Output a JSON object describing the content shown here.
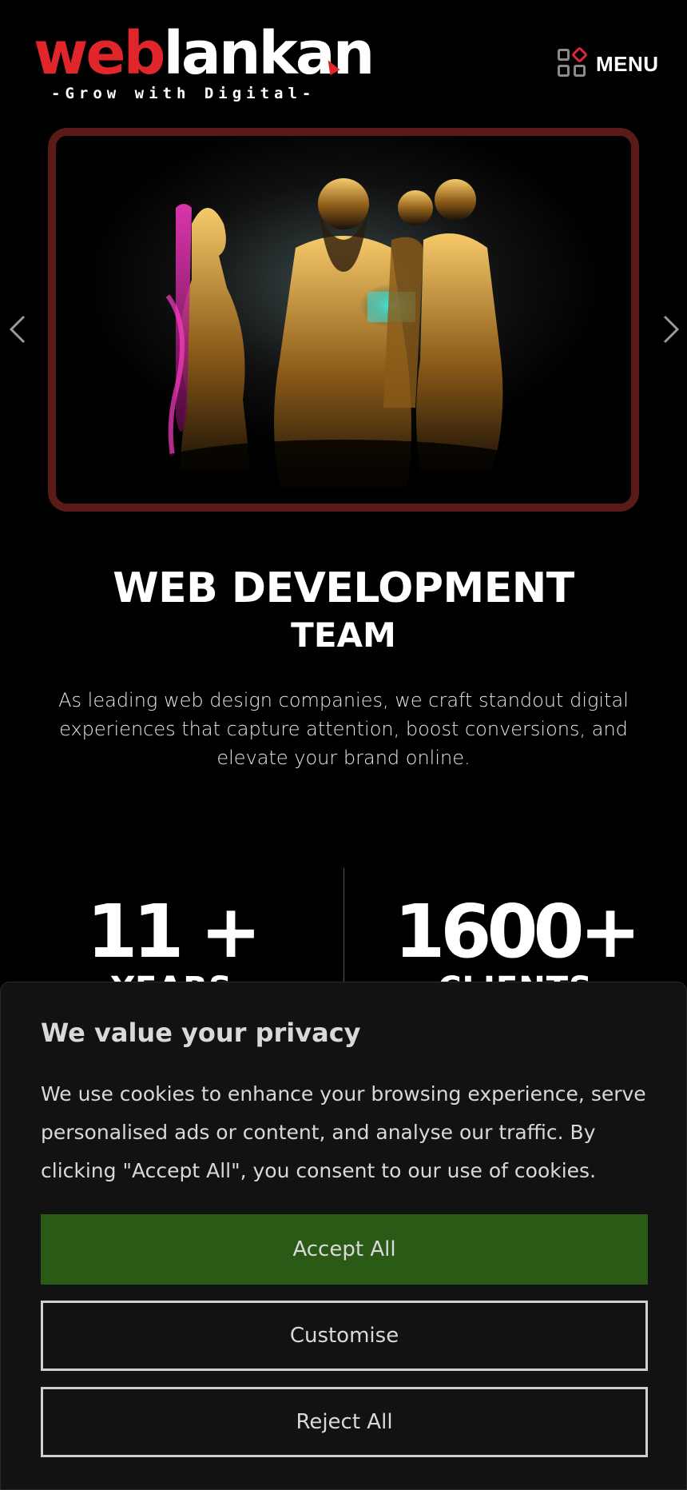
{
  "header": {
    "logo_part_red": "web",
    "logo_part_white": "lankan",
    "tagline": "-Grow with Digital-",
    "menu_label": "MENU"
  },
  "colors": {
    "brand_red": "#e0262b",
    "frame_border": "#5a1a17",
    "accept_green": "#2b5a17",
    "panel_bg": "#121212"
  },
  "icons": {
    "menu": "grid-menu-icon",
    "prev": "chevron-left-icon",
    "next": "chevron-right-icon"
  },
  "hero": {
    "title": "WEB DEVELOPMENT",
    "subtitle": "TEAM",
    "description": "As leading web design companies, we craft standout digital experiences that capture attention, boost conversions, and elevate your brand online."
  },
  "stats": [
    {
      "value": "11 +",
      "label": "YEARS"
    },
    {
      "value": "1600+",
      "label": "CLIENTS"
    }
  ],
  "cookie": {
    "title": "We value your privacy",
    "text": "We use cookies to enhance your browsing experience, serve personalised ads or content, and analyse our traffic. By clicking \"Accept All\", you consent to our use of cookies.",
    "accept_label": "Accept All",
    "customise_label": "Customise",
    "reject_label": "Reject All"
  }
}
